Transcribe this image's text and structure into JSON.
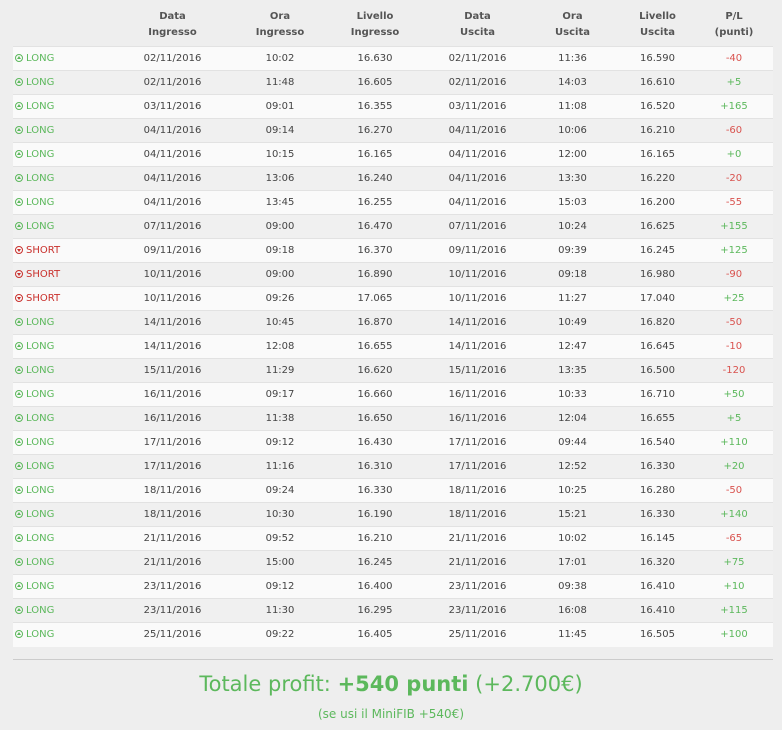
{
  "headers": {
    "entry_date": [
      "Data",
      "Ingresso"
    ],
    "entry_time": [
      "Ora",
      "Ingresso"
    ],
    "entry_level": [
      "Livello",
      "Ingresso"
    ],
    "exit_date": [
      "Data",
      "Uscita"
    ],
    "exit_time": [
      "Ora",
      "Uscita"
    ],
    "exit_level": [
      "Livello",
      "Uscita"
    ],
    "pl": [
      "P/L",
      "(punti)"
    ]
  },
  "colors": {
    "long": "#5cb85c",
    "short": "#c9302c",
    "positive": "#5cb85c",
    "negative": "#d9534f"
  },
  "trades": [
    {
      "dir": "LONG",
      "entry_date": "02/11/2016",
      "entry_time": "10:02",
      "entry_level": "16.630",
      "exit_date": "02/11/2016",
      "exit_time": "11:36",
      "exit_level": "16.590",
      "pl": "-40"
    },
    {
      "dir": "LONG",
      "entry_date": "02/11/2016",
      "entry_time": "11:48",
      "entry_level": "16.605",
      "exit_date": "02/11/2016",
      "exit_time": "14:03",
      "exit_level": "16.610",
      "pl": "+5"
    },
    {
      "dir": "LONG",
      "entry_date": "03/11/2016",
      "entry_time": "09:01",
      "entry_level": "16.355",
      "exit_date": "03/11/2016",
      "exit_time": "11:08",
      "exit_level": "16.520",
      "pl": "+165"
    },
    {
      "dir": "LONG",
      "entry_date": "04/11/2016",
      "entry_time": "09:14",
      "entry_level": "16.270",
      "exit_date": "04/11/2016",
      "exit_time": "10:06",
      "exit_level": "16.210",
      "pl": "-60"
    },
    {
      "dir": "LONG",
      "entry_date": "04/11/2016",
      "entry_time": "10:15",
      "entry_level": "16.165",
      "exit_date": "04/11/2016",
      "exit_time": "12:00",
      "exit_level": "16.165",
      "pl": "+0"
    },
    {
      "dir": "LONG",
      "entry_date": "04/11/2016",
      "entry_time": "13:06",
      "entry_level": "16.240",
      "exit_date": "04/11/2016",
      "exit_time": "13:30",
      "exit_level": "16.220",
      "pl": "-20"
    },
    {
      "dir": "LONG",
      "entry_date": "04/11/2016",
      "entry_time": "13:45",
      "entry_level": "16.255",
      "exit_date": "04/11/2016",
      "exit_time": "15:03",
      "exit_level": "16.200",
      "pl": "-55"
    },
    {
      "dir": "LONG",
      "entry_date": "07/11/2016",
      "entry_time": "09:00",
      "entry_level": "16.470",
      "exit_date": "07/11/2016",
      "exit_time": "10:24",
      "exit_level": "16.625",
      "pl": "+155"
    },
    {
      "dir": "SHORT",
      "entry_date": "09/11/2016",
      "entry_time": "09:18",
      "entry_level": "16.370",
      "exit_date": "09/11/2016",
      "exit_time": "09:39",
      "exit_level": "16.245",
      "pl": "+125"
    },
    {
      "dir": "SHORT",
      "entry_date": "10/11/2016",
      "entry_time": "09:00",
      "entry_level": "16.890",
      "exit_date": "10/11/2016",
      "exit_time": "09:18",
      "exit_level": "16.980",
      "pl": "-90"
    },
    {
      "dir": "SHORT",
      "entry_date": "10/11/2016",
      "entry_time": "09:26",
      "entry_level": "17.065",
      "exit_date": "10/11/2016",
      "exit_time": "11:27",
      "exit_level": "17.040",
      "pl": "+25"
    },
    {
      "dir": "LONG",
      "entry_date": "14/11/2016",
      "entry_time": "10:45",
      "entry_level": "16.870",
      "exit_date": "14/11/2016",
      "exit_time": "10:49",
      "exit_level": "16.820",
      "pl": "-50"
    },
    {
      "dir": "LONG",
      "entry_date": "14/11/2016",
      "entry_time": "12:08",
      "entry_level": "16.655",
      "exit_date": "14/11/2016",
      "exit_time": "12:47",
      "exit_level": "16.645",
      "pl": "-10"
    },
    {
      "dir": "LONG",
      "entry_date": "15/11/2016",
      "entry_time": "11:29",
      "entry_level": "16.620",
      "exit_date": "15/11/2016",
      "exit_time": "13:35",
      "exit_level": "16.500",
      "pl": "-120"
    },
    {
      "dir": "LONG",
      "entry_date": "16/11/2016",
      "entry_time": "09:17",
      "entry_level": "16.660",
      "exit_date": "16/11/2016",
      "exit_time": "10:33",
      "exit_level": "16.710",
      "pl": "+50"
    },
    {
      "dir": "LONG",
      "entry_date": "16/11/2016",
      "entry_time": "11:38",
      "entry_level": "16.650",
      "exit_date": "16/11/2016",
      "exit_time": "12:04",
      "exit_level": "16.655",
      "pl": "+5"
    },
    {
      "dir": "LONG",
      "entry_date": "17/11/2016",
      "entry_time": "09:12",
      "entry_level": "16.430",
      "exit_date": "17/11/2016",
      "exit_time": "09:44",
      "exit_level": "16.540",
      "pl": "+110"
    },
    {
      "dir": "LONG",
      "entry_date": "17/11/2016",
      "entry_time": "11:16",
      "entry_level": "16.310",
      "exit_date": "17/11/2016",
      "exit_time": "12:52",
      "exit_level": "16.330",
      "pl": "+20"
    },
    {
      "dir": "LONG",
      "entry_date": "18/11/2016",
      "entry_time": "09:24",
      "entry_level": "16.330",
      "exit_date": "18/11/2016",
      "exit_time": "10:25",
      "exit_level": "16.280",
      "pl": "-50"
    },
    {
      "dir": "LONG",
      "entry_date": "18/11/2016",
      "entry_time": "10:30",
      "entry_level": "16.190",
      "exit_date": "18/11/2016",
      "exit_time": "15:21",
      "exit_level": "16.330",
      "pl": "+140"
    },
    {
      "dir": "LONG",
      "entry_date": "21/11/2016",
      "entry_time": "09:52",
      "entry_level": "16.210",
      "exit_date": "21/11/2016",
      "exit_time": "10:02",
      "exit_level": "16.145",
      "pl": "-65"
    },
    {
      "dir": "LONG",
      "entry_date": "21/11/2016",
      "entry_time": "15:00",
      "entry_level": "16.245",
      "exit_date": "21/11/2016",
      "exit_time": "17:01",
      "exit_level": "16.320",
      "pl": "+75"
    },
    {
      "dir": "LONG",
      "entry_date": "23/11/2016",
      "entry_time": "09:12",
      "entry_level": "16.400",
      "exit_date": "23/11/2016",
      "exit_time": "09:38",
      "exit_level": "16.410",
      "pl": "+10"
    },
    {
      "dir": "LONG",
      "entry_date": "23/11/2016",
      "entry_time": "11:30",
      "entry_level": "16.295",
      "exit_date": "23/11/2016",
      "exit_time": "16:08",
      "exit_level": "16.410",
      "pl": "+115"
    },
    {
      "dir": "LONG",
      "entry_date": "25/11/2016",
      "entry_time": "09:22",
      "entry_level": "16.405",
      "exit_date": "25/11/2016",
      "exit_time": "11:45",
      "exit_level": "16.505",
      "pl": "+100"
    }
  ],
  "summary": {
    "label": "Totale profit:",
    "points": "+540 punti",
    "euro": "(+2.700€)",
    "note": "(se usi il MiniFIB +540€)"
  }
}
